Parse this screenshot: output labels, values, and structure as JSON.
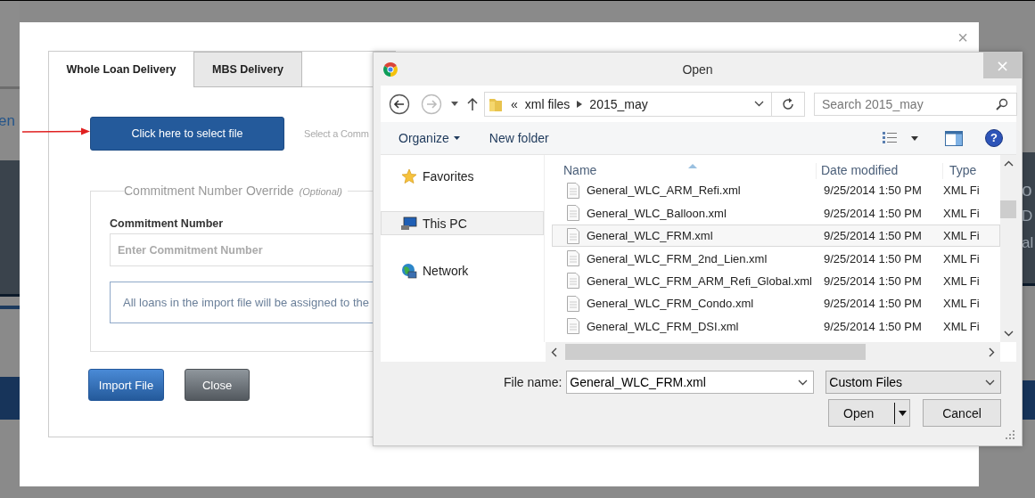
{
  "background_fragments": [
    {
      "text": "en",
      "kind": "left"
    },
    {
      "text": "o",
      "kind": "right"
    },
    {
      "text": "D",
      "kind": "right"
    },
    {
      "text": "al",
      "kind": "right"
    }
  ],
  "modal": {
    "close": "×",
    "tabs": [
      {
        "label": "Whole Loan Delivery",
        "selected": true
      },
      {
        "label": "MBS Delivery",
        "selected": false
      }
    ],
    "select_button": "Click here to select file",
    "select_hint": "Select a Comm",
    "override": {
      "legend": "Commitment Number Override",
      "optional": "(Optional)",
      "label": "Commitment Number",
      "placeholder": "Enter Commitment Number",
      "note": "All loans in the import file will be assigned to the"
    },
    "buttons": [
      {
        "label": "Import File",
        "kind": "primary"
      },
      {
        "label": "Close",
        "kind": "secondary"
      }
    ]
  },
  "open_dialog": {
    "title": "Open",
    "close": "×",
    "breadcrumb": {
      "overflow": "«",
      "items": [
        "xml files",
        "2015_may"
      ]
    },
    "search": {
      "placeholder": "Search 2015_may"
    },
    "toolbar": [
      "Organize",
      "New folder"
    ],
    "help": "?",
    "nav": [
      {
        "label": "Favorites",
        "kind": "favorites",
        "selected": false
      },
      {
        "label": "This PC",
        "kind": "computer",
        "selected": true
      },
      {
        "label": "Network",
        "kind": "network",
        "selected": false
      }
    ],
    "columns": [
      "Name",
      "Date modified",
      "Type"
    ],
    "files": [
      {
        "name": "General_WLC_ARM_Refi.xml",
        "date": "9/25/2014 1:50 PM",
        "type": "XML Fi",
        "selected": false
      },
      {
        "name": "General_WLC_Balloon.xml",
        "date": "9/25/2014 1:50 PM",
        "type": "XML Fi",
        "selected": false
      },
      {
        "name": "General_WLC_FRM.xml",
        "date": "9/25/2014 1:50 PM",
        "type": "XML Fi",
        "selected": true
      },
      {
        "name": "General_WLC_FRM_2nd_Lien.xml",
        "date": "9/25/2014 1:50 PM",
        "type": "XML Fi",
        "selected": false
      },
      {
        "name": "General_WLC_FRM_ARM_Refi_Global.xml",
        "date": "9/25/2014 1:50 PM",
        "type": "XML Fi",
        "selected": false
      },
      {
        "name": "General_WLC_FRM_Condo.xml",
        "date": "9/25/2014 1:50 PM",
        "type": "XML Fi",
        "selected": false
      },
      {
        "name": "General_WLC_FRM_DSI.xml",
        "date": "9/25/2014 1:50 PM",
        "type": "XML Fi",
        "selected": false
      }
    ],
    "file_name_label": "File name:",
    "file_name": "General_WLC_FRM.xml",
    "filter": "Custom Files",
    "buttons": [
      {
        "label": "Open",
        "kind": "split"
      },
      {
        "label": "Cancel",
        "kind": "plain"
      }
    ]
  }
}
